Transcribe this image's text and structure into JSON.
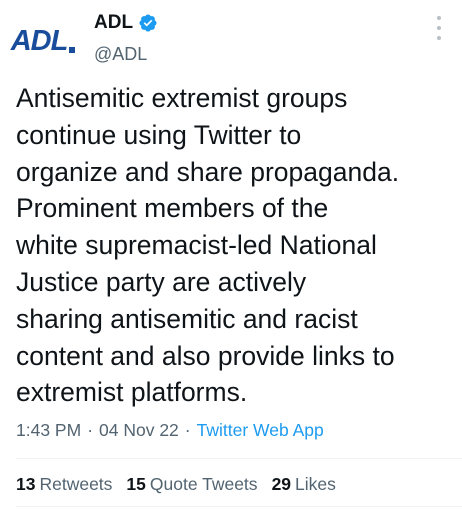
{
  "account": {
    "logo_text": "ADL",
    "display_name": "ADL",
    "handle": "@ADL",
    "verified": true
  },
  "tweet": {
    "text": "Antisemitic extremist groups\ncontinue using Twitter to\norganize and share propaganda.\nProminent members of the\nwhite supremacist-led National\nJustice party are actively\nsharing antisemitic and racist\ncontent and also provide links to\nextremist platforms.",
    "time": "1:43 PM",
    "date": "04 Nov 22",
    "source": "Twitter Web App",
    "separator": "·"
  },
  "stats": {
    "retweets_count": "13",
    "retweets_label": "Retweets",
    "quote_tweets_count": "15",
    "quote_tweets_label": "Quote Tweets",
    "likes_count": "29",
    "likes_label": "Likes"
  },
  "colors": {
    "brand_blue": "#1a4c9c",
    "twitter_blue": "#1d9bf0",
    "secondary_text": "#536471"
  },
  "icons": [
    "adl-logo",
    "verified-badge-icon",
    "more-options-icon"
  ]
}
